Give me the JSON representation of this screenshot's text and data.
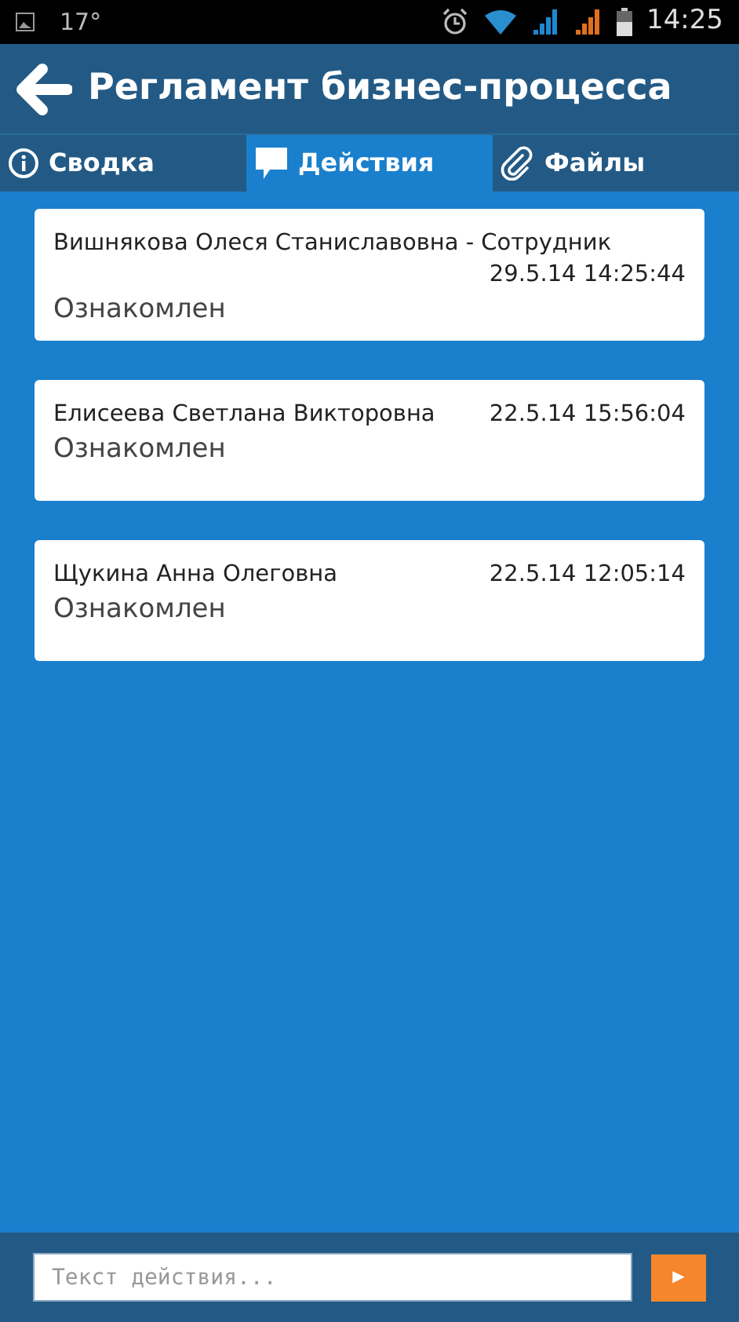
{
  "status_bar": {
    "temperature": "17°",
    "time": "14:25"
  },
  "header": {
    "title": "Регламент бизнес-процесса"
  },
  "tabs": [
    {
      "label": "Сводка",
      "kind": "info",
      "selected": false
    },
    {
      "label": "Действия",
      "kind": "comment",
      "selected": true
    },
    {
      "label": "Файлы",
      "kind": "clip",
      "selected": false
    }
  ],
  "actions": [
    {
      "name": "Вишнякова Олеся Станиславовна - Сотрудник",
      "date": "29.5.14 14:25:44",
      "status": "Ознакомлен"
    },
    {
      "name": "Елисеева Светлана Викторовна",
      "date": "22.5.14 15:56:04",
      "status": "Ознакомлен"
    },
    {
      "name": "Щукина Анна Олеговна",
      "date": "22.5.14 12:05:14",
      "status": "Ознакомлен"
    }
  ],
  "composer": {
    "placeholder": "Текст действия...",
    "send_icon": "▶"
  }
}
